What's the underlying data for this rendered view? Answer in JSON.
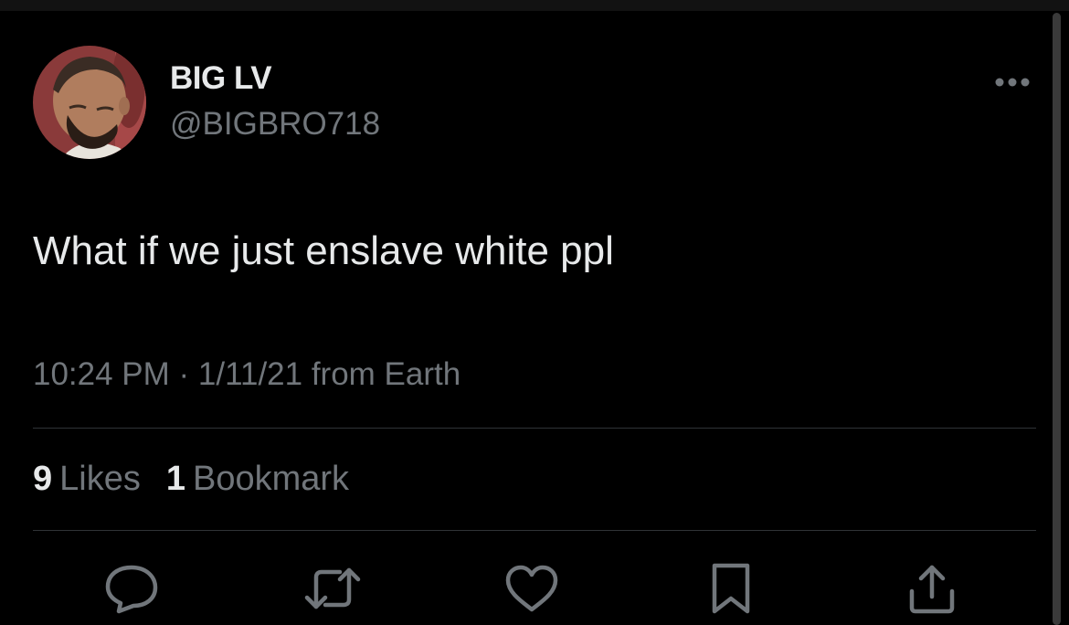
{
  "author": {
    "display_name": "BIG LV",
    "handle": "@BIGBRO718"
  },
  "tweet": {
    "text": "What if we just enslave white ppl",
    "time": "10:24 PM",
    "separator": " · ",
    "date": "1/11/21",
    "location_text": " from Earth"
  },
  "stats": {
    "likes_count": "9",
    "likes_label": "Likes",
    "bookmarks_count": "1",
    "bookmarks_label": "Bookmark"
  },
  "actions": {
    "reply_icon": "reply-icon",
    "retweet_icon": "retweet-icon",
    "like_icon": "heart-icon",
    "bookmark_icon": "bookmark-icon",
    "share_icon": "share-icon"
  },
  "colors": {
    "background": "#000000",
    "primary_text": "#e7e9ea",
    "secondary_text": "#71767b",
    "divider": "#2f3336"
  }
}
